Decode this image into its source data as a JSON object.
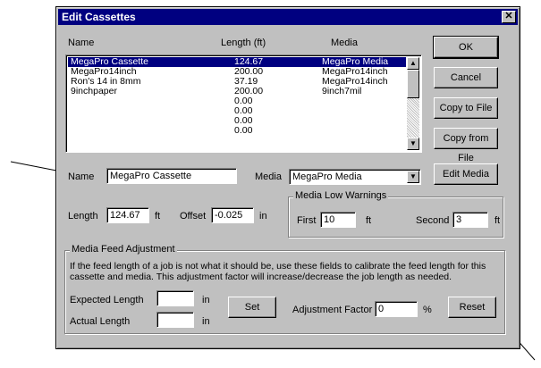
{
  "dialog": {
    "title": "Edit Cassettes",
    "close_glyph": "✕"
  },
  "list": {
    "headers": {
      "name": "Name",
      "length": "Length (ft)",
      "media": "Media"
    },
    "rows": [
      {
        "name": "MegaPro Cassette",
        "length": "124.67",
        "media": "MegaPro Media",
        "selected": true
      },
      {
        "name": "MegaPro14inch",
        "length": "200.00",
        "media": "MegaPro14inch"
      },
      {
        "name": "Ron's 14 in 8mm",
        "length": "37.19",
        "media": "MegaPro14inch"
      },
      {
        "name": "9inchpaper",
        "length": "200.00",
        "media": "9inch7mil"
      },
      {
        "name": "",
        "length": "0.00",
        "media": ""
      },
      {
        "name": "",
        "length": "0.00",
        "media": ""
      },
      {
        "name": "",
        "length": "0.00",
        "media": ""
      },
      {
        "name": "",
        "length": "0.00",
        "media": ""
      }
    ]
  },
  "buttons": {
    "ok": "OK",
    "cancel": "Cancel",
    "copy_to_file": "Copy to File",
    "copy_from_file": "Copy from File",
    "edit_media": "Edit Media",
    "set": "Set",
    "reset": "Reset"
  },
  "form": {
    "name_label": "Name",
    "name_value": "MegaPro Cassette",
    "media_label": "Media",
    "media_value": "MegaPro Media",
    "length_label": "Length",
    "length_value": "124.67",
    "length_unit": "ft",
    "offset_label": "Offset",
    "offset_value": "-0.025",
    "offset_unit": "in"
  },
  "warnings": {
    "title": "Media Low Warnings",
    "first_label": "First",
    "first_value": "10",
    "first_unit": "ft",
    "second_label": "Second",
    "second_value": "3",
    "second_unit": "ft"
  },
  "feed": {
    "title": "Media Feed Adjustment",
    "description": "If the feed length of a job is not what it should be, use these fields to calibrate the feed length for this cassette and media. This adjustment factor will increase/decrease the job length as needed.",
    "expected_label": "Expected Length",
    "expected_value": "",
    "expected_unit": "in",
    "actual_label": "Actual Length",
    "actual_value": "",
    "actual_unit": "in",
    "factor_label": "Adjustment Factor",
    "factor_value": "0",
    "factor_unit": "%"
  },
  "icons": {
    "scroll_up": "▲",
    "scroll_down": "▼",
    "dropdown": "▼"
  }
}
